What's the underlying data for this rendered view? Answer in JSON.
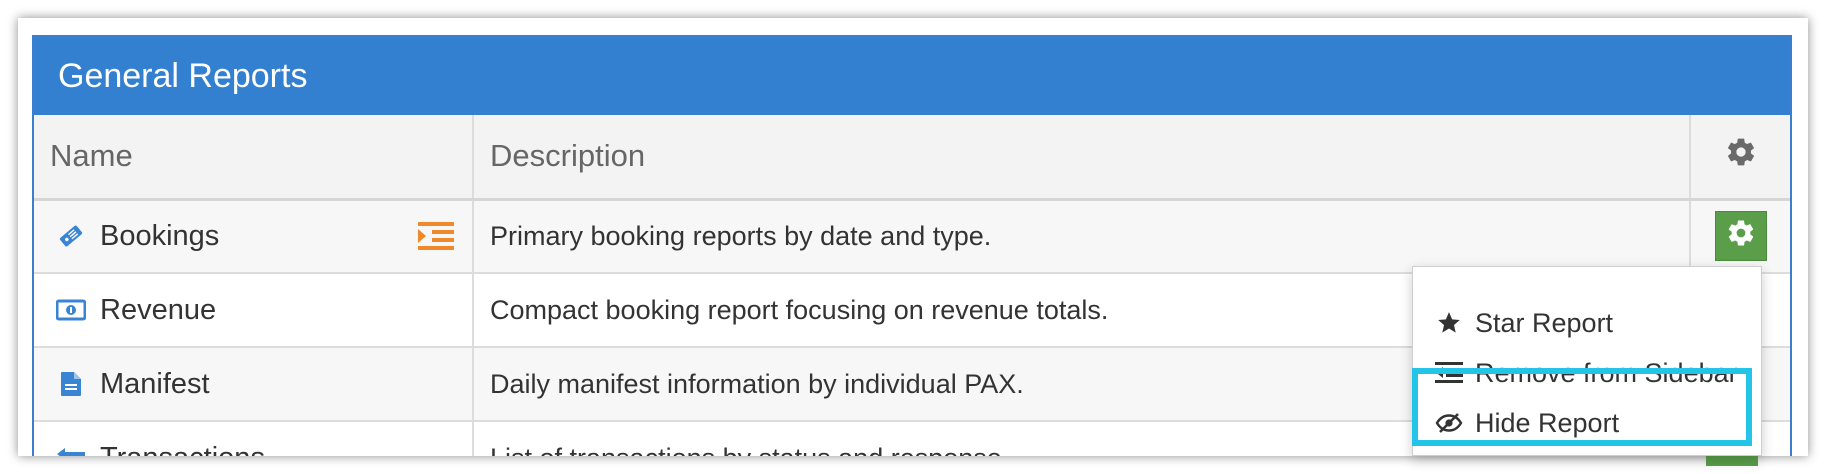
{
  "panel": {
    "title": "General Reports"
  },
  "table": {
    "headers": {
      "name": "Name",
      "description": "Description"
    },
    "rows": [
      {
        "name": "Bookings",
        "icon": "ticket-icon",
        "description": "Primary booking reports by date and type.",
        "in_sidebar": true
      },
      {
        "name": "Revenue",
        "icon": "money-icon",
        "description": "Compact booking report focusing on revenue totals.",
        "in_sidebar": false
      },
      {
        "name": "Manifest",
        "icon": "document-icon",
        "description": "Daily manifest information by individual PAX.",
        "in_sidebar": false
      },
      {
        "name": "Transactions",
        "icon": "transactions-icon",
        "description": "List of transactions by status and response.",
        "in_sidebar": false
      }
    ]
  },
  "menu": {
    "items": [
      {
        "label": "Star Report",
        "icon": "star-icon"
      },
      {
        "label": "Remove from Sidebar",
        "icon": "outdent-icon"
      },
      {
        "label": "Hide Report",
        "icon": "eye-slash-icon"
      }
    ]
  },
  "colors": {
    "header_blue": "#3380d0",
    "gear_green": "#5a9e4a",
    "highlight_cyan": "#23c4e8",
    "sidebar_orange": "#f0892a",
    "icon_blue": "#3a84d4"
  }
}
